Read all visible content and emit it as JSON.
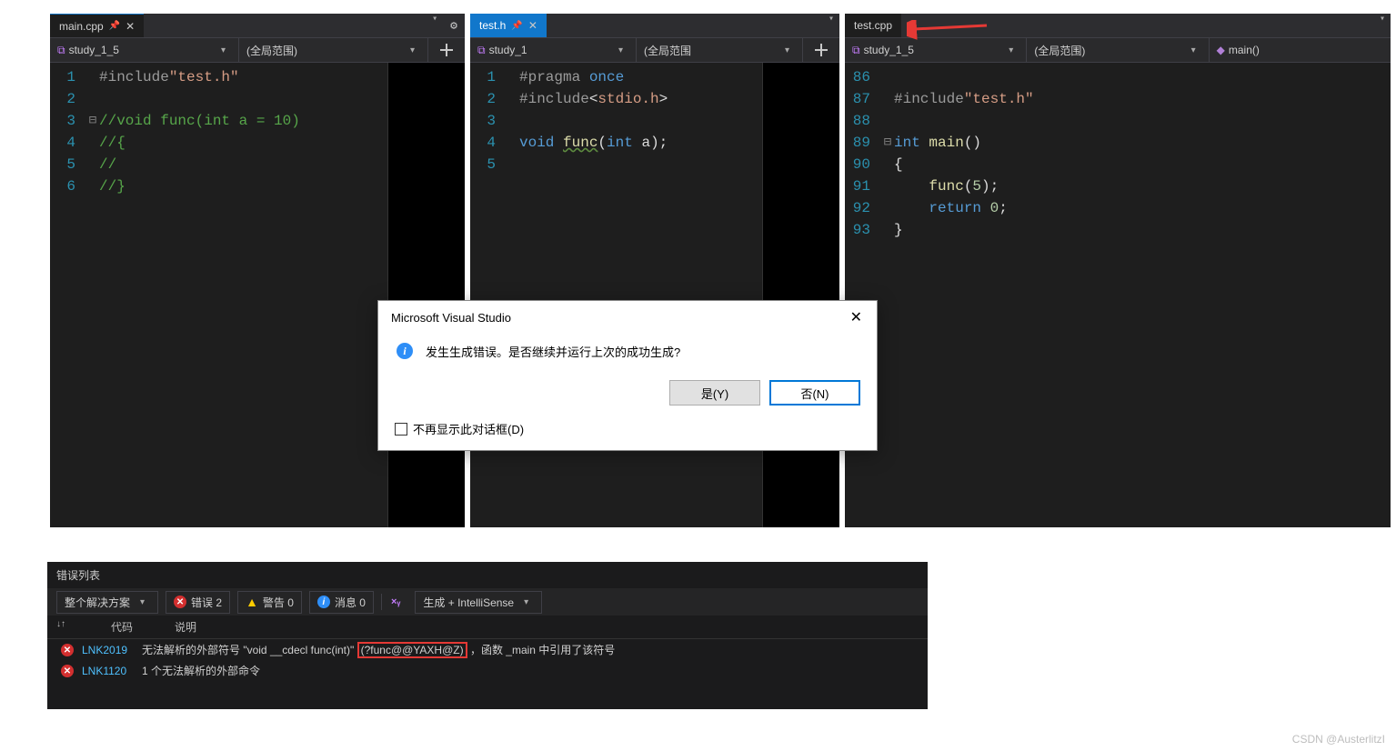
{
  "panes": [
    {
      "tab": "main.cpp",
      "project": "study_1_5",
      "scope": "(全局范围)",
      "code": {
        "1": {
          "text": "#include\"test.h\"",
          "cls": "pp"
        },
        "2": {
          "text": "",
          "cls": ""
        },
        "3": {
          "text": "//void func(int a = 10)",
          "cls": "cmt",
          "collapse": "⊟"
        },
        "4": {
          "text": "//{",
          "cls": "cmt"
        },
        "5": {
          "text": "//",
          "cls": "cmt"
        },
        "6": {
          "text": "//}",
          "cls": "cmt"
        }
      }
    },
    {
      "tab": "test.h",
      "project": "study_1",
      "scope": "(全局范围",
      "code": {
        "1": {
          "text": "#pragma once",
          "cls": "pp"
        },
        "2": {
          "text": "#include<stdio.h>",
          "cls": "pp inc"
        },
        "3": {
          "text": "",
          "cls": ""
        },
        "4": {
          "line": "decl"
        },
        "5": {
          "text": "",
          "cls": ""
        }
      }
    },
    {
      "tab": "test.cpp",
      "project": "study_1_5",
      "scope": "(全局范围)",
      "funcsel": "main()",
      "startLine": 86,
      "code": {
        "86": {
          "text": "",
          "cls": ""
        },
        "87": {
          "text": "#include\"test.h\"",
          "cls": "pp"
        },
        "88": {
          "text": "",
          "cls": ""
        },
        "89": {
          "line": "mainDecl",
          "collapse": "⊟"
        },
        "90": {
          "text": "{",
          "cls": "txt"
        },
        "91": {
          "line": "funcCall"
        },
        "92": {
          "line": "return0"
        },
        "93": {
          "text": "}",
          "cls": "txt"
        }
      }
    }
  ],
  "dialog": {
    "title": "Microsoft Visual Studio",
    "message": "发生生成错误。是否继续并运行上次的成功生成?",
    "yes": "是(Y)",
    "no": "否(N)",
    "checkbox": "不再显示此对话框(D)"
  },
  "errorPanel": {
    "title": "错误列表",
    "solutionScope": "整个解决方案",
    "errCount": "错误 2",
    "warnCount": "警告 0",
    "infoCount": "消息 0",
    "buildFilter": "生成 + IntelliSense",
    "colCode": "代码",
    "colDesc": "说明",
    "rows": [
      {
        "code": "LNK2019",
        "descPrefix": "无法解析的外部符号 \"void __cdecl func(int)\" ",
        "symbol": "(?func@@YAXH@Z)",
        "descSuffix": "，函数 _main 中引用了该符号"
      },
      {
        "code": "LNK1120",
        "desc": "1 个无法解析的外部命令"
      }
    ]
  },
  "watermark": "CSDN @AusterlitzI",
  "syntax": {
    "voidKw": "void",
    "funcName": "func",
    "intKw": "int",
    "paramA": "a",
    "pragma": "#pragma",
    "once": "once",
    "includeKw": "#include",
    "stdio": "stdio.h",
    "testH": "test.h",
    "mainKw": "int",
    "mainName": "main",
    "returnKw": "return",
    "zero": "0",
    "five": "5"
  }
}
